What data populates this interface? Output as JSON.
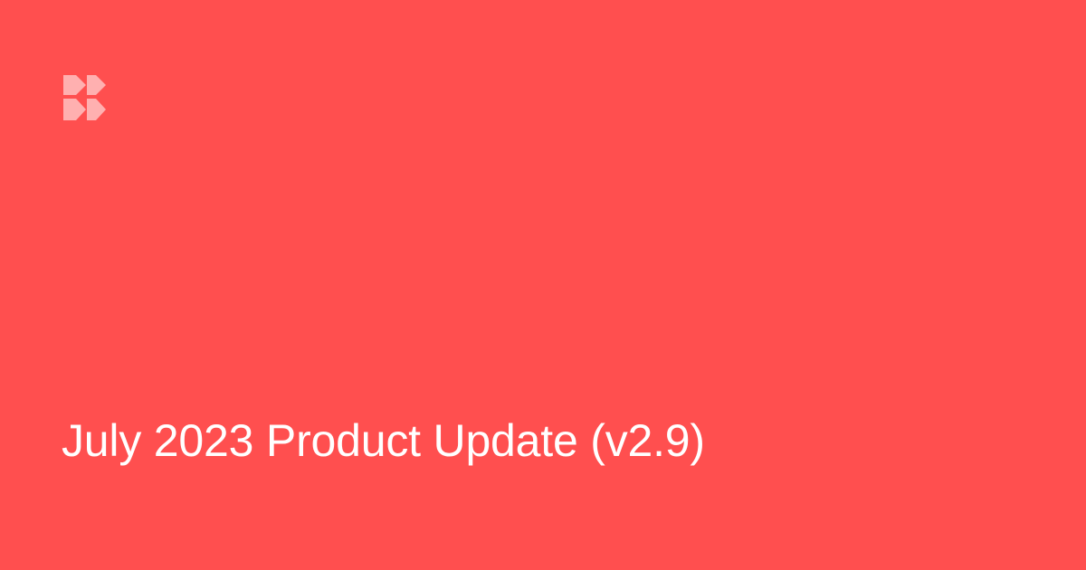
{
  "brand": {
    "logo_icon": "brand-logo-icon",
    "background_color": "#ff4f4f",
    "logo_color": "#ffb0b0",
    "text_color": "#ffffff"
  },
  "content": {
    "title": "July 2023 Product Update (v2.9)"
  }
}
